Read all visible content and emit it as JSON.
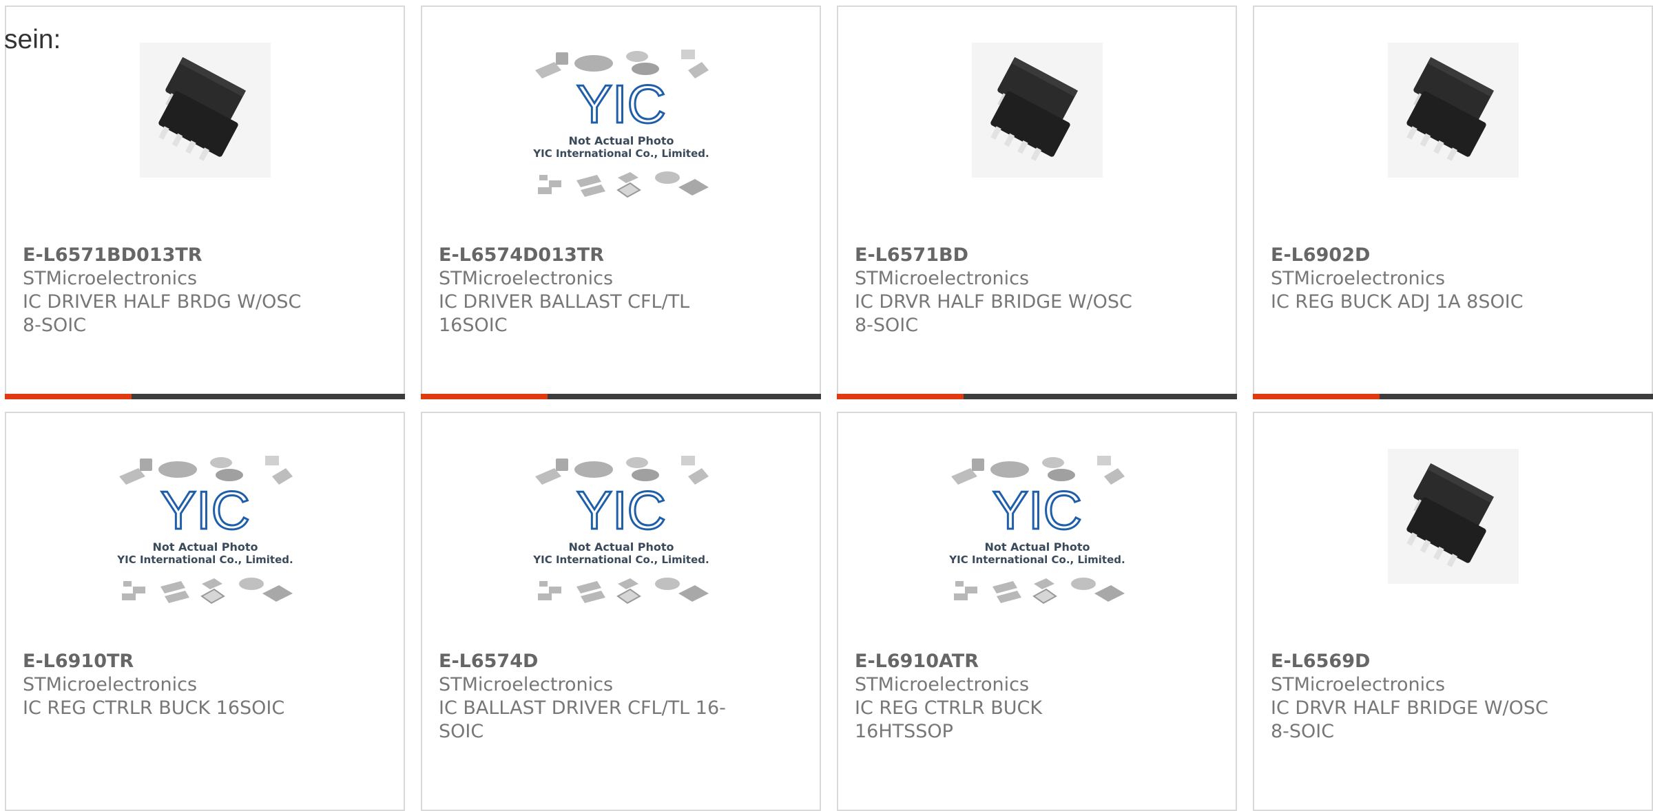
{
  "intro": {
    "text": "sein:"
  },
  "placeholder_photo": {
    "brand": "YIC",
    "line1": "Not Actual Photo",
    "line2": "YIC International Co., Limited."
  },
  "colors": {
    "accent": "#e03a12",
    "bar": "#3d3d3d",
    "chip": "#2b2b2b",
    "brand_blue": "#1f5faa"
  },
  "products": [
    {
      "part_number": "E-L6571BD013TR",
      "manufacturer": "STMicroelectronics",
      "description": "IC DRIVER HALF BRDG W/OSC 8-SOIC",
      "image": "soic-8-chip"
    },
    {
      "part_number": "E-L6574D013TR",
      "manufacturer": "STMicroelectronics",
      "description": "IC DRIVER BALLAST CFL/TL 16SOIC",
      "image": "placeholder"
    },
    {
      "part_number": "E-L6571BD",
      "manufacturer": "STMicroelectronics",
      "description": "IC DRVR HALF BRIDGE W/OSC 8-SOIC",
      "image": "soic-8-chip"
    },
    {
      "part_number": "E-L6902D",
      "manufacturer": "STMicroelectronics",
      "description": "IC REG BUCK ADJ 1A 8SOIC",
      "image": "soic-8-chip"
    },
    {
      "part_number": "E-L6910TR",
      "manufacturer": "STMicroelectronics",
      "description": "IC REG CTRLR BUCK 16SOIC",
      "image": "placeholder"
    },
    {
      "part_number": "E-L6574D",
      "manufacturer": "STMicroelectronics",
      "description": "IC BALLAST DRIVER CFL/TL 16-SOIC",
      "image": "placeholder"
    },
    {
      "part_number": "E-L6910ATR",
      "manufacturer": "STMicroelectronics",
      "description": "IC REG CTRLR BUCK 16HTSSOP",
      "image": "placeholder"
    },
    {
      "part_number": "E-L6569D",
      "manufacturer": "STMicroelectronics",
      "description": "IC DRVR HALF BRIDGE W/OSC 8-SOIC",
      "image": "soic-8-chip"
    }
  ]
}
